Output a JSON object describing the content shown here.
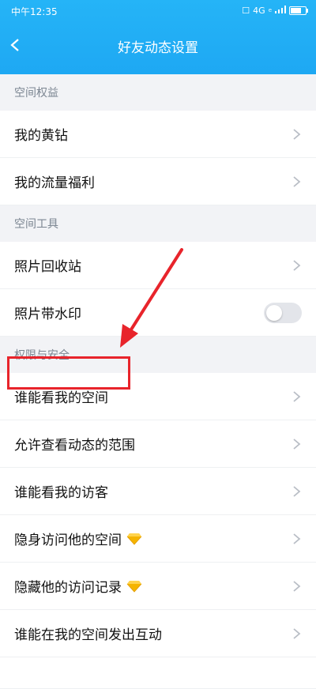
{
  "status": {
    "time": "中午12:35",
    "network": "4G",
    "network_sub": "e"
  },
  "header": {
    "title": "好友动态设置"
  },
  "sections": [
    {
      "title": "空间权益",
      "items": [
        {
          "label": "我的黄钻",
          "type": "link"
        },
        {
          "label": "我的流量福利",
          "type": "link"
        }
      ]
    },
    {
      "title": "空间工具",
      "items": [
        {
          "label": "照片回收站",
          "type": "link"
        },
        {
          "label": "照片带水印",
          "type": "toggle",
          "on": false
        }
      ]
    },
    {
      "title": "权限与安全",
      "items": [
        {
          "label": "谁能看我的空间",
          "type": "link",
          "highlighted": true
        },
        {
          "label": "允许查看动态的范围",
          "type": "link"
        },
        {
          "label": "谁能看我的访客",
          "type": "link"
        },
        {
          "label": "隐身访问他的空间",
          "type": "link",
          "icon": "yellow-diamond-icon"
        },
        {
          "label": "隐藏他的访问记录",
          "type": "link",
          "icon": "yellow-diamond-icon"
        },
        {
          "label": "谁能在我的空间发出互动",
          "type": "link"
        }
      ]
    }
  ],
  "colors": {
    "header": "#1ea8f3",
    "highlight": "#e8242b",
    "diamond": "#f5b400"
  }
}
